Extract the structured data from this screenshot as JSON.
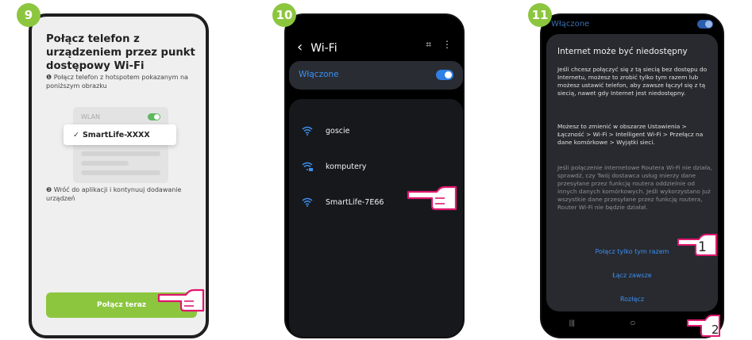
{
  "steps": [
    "9",
    "10",
    "11"
  ],
  "colors": {
    "brand_green": "#8cc63f",
    "accent_blue": "#3d8ff0",
    "hand_pink": "#e0186f"
  },
  "phone1": {
    "title": "Połącz telefon z urządzeniem przez punkt dostępowy Wi-Fi",
    "step1": "❶ Połącz telefon z hotspotem pokazanym na poniższym obrazku",
    "wlan_label": "WLAN",
    "selected_network": "SmartLife-XXXX",
    "check_mark": "✓",
    "step2": "❷ Wróć do aplikacji i kontynuuj dodawanie urządzeń",
    "connect_button": "Połącz teraz"
  },
  "phone2": {
    "back_icon": "‹",
    "title": "Wi-Fi",
    "scan_icon": "⌗",
    "menu_icon": "⋮",
    "enabled_label": "Włączone",
    "networks": [
      {
        "name": "goscie",
        "icon": "wifi-icon"
      },
      {
        "name": "komputery",
        "icon": "wifi-lock-icon"
      },
      {
        "name": "SmartLife-7E66",
        "icon": "wifi-icon"
      }
    ]
  },
  "phone3": {
    "bg_label": "Włączone",
    "dialog_title": "Internet może być niedostępny",
    "para1": "Jeśli chcesz połączyć się z tą siecią bez dostępu do Internetu, możesz to zrobić tylko tym razem lub możesz ustawić telefon, aby zawsze łączył się z tą siecią, nawet gdy Internet jest niedostępny.",
    "para2": "Możesz to zmienić w obszarze Ustawienia > Łączność > Wi-Fi > Intelligent Wi-Fi > Przełącz na dane komórkowe > Wyjątki sieci.",
    "para3": "Jeśli połączenie internetowe Routera Wi-Fi nie działa, sprawdź, czy Twój dostawca usług mierzy dane przesyłane przez funkcję routera oddzielnie od innych danych komórkowych. Jeśli wykorzystano już wszystkie dane przesyłane przez funkcję routera, Router Wi-Fi nie będzie działał.",
    "btn_once": "Połącz tylko tym razem",
    "btn_always": "Łącz zawsze",
    "btn_disconnect": "Rozłącz",
    "nav_recents": "|||",
    "nav_home": "○",
    "nav_back": "‹",
    "marker1": "1",
    "marker2": "2"
  }
}
